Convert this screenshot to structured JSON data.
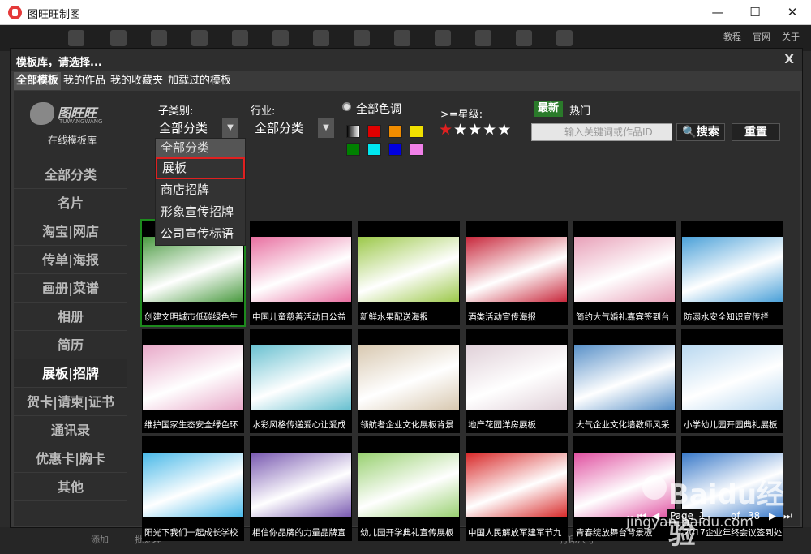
{
  "window": {
    "title": "图旺旺制图",
    "minimize": "—",
    "maximize": "☐",
    "close": "✕"
  },
  "background": {
    "links": [
      "教程",
      "官网",
      "关于"
    ],
    "bottom_add": "添加",
    "bottom_batch": "批处理",
    "bottom_print_size": "打印尺寸"
  },
  "dialog": {
    "title": "模板库，请选择...",
    "close": "X",
    "tabs": [
      "全部模板",
      "我的作品",
      "我的收藏夹",
      "加载过的模板"
    ],
    "logo_text": "图旺旺",
    "logo_sub": "TUWANGWANG",
    "logo_caption": "在线模板库",
    "sidebar": [
      "全部分类",
      "名片",
      "淘宝|网店",
      "传单|海报",
      "画册|菜谱",
      "相册",
      "简历",
      "展板|招牌",
      "贺卡|请柬|证书",
      "通讯录",
      "优惠卡|胸卡",
      "其他"
    ],
    "filters": {
      "subcategory_label": "子类别:",
      "subcategory_value": "全部分类",
      "industry_label": "行业:",
      "industry_value": "全部分类",
      "color_label": "全部色调",
      "stars_label": ">=星级:",
      "swatch_colors": [
        "gradient",
        "#e00000",
        "#f08c00",
        "#f0e000",
        "#008000",
        "#00e8f0",
        "#0000e0",
        "#f080e8"
      ],
      "dropdown_options": [
        "全部分类",
        "展板",
        "商店招牌",
        "形象宣传招牌",
        "公司宣传标语"
      ],
      "newest": "最新",
      "hot": "热门",
      "search_placeholder": "输入关键词或作品ID",
      "search_button": "搜索",
      "reset_button": "重置"
    },
    "templates": [
      {
        "label": "创建文明城市低碳绿色生",
        "color": "#4a9a40"
      },
      {
        "label": "中国儿童慈善活动日公益",
        "color": "#e86fa0"
      },
      {
        "label": "新鲜水果配送海报",
        "color": "#9cc84a"
      },
      {
        "label": "酒类活动宣传海报",
        "color": "#c8283c"
      },
      {
        "label": "简约大气婚礼嘉宾签到台",
        "color": "#e8a0b8"
      },
      {
        "label": "防溺水安全知识宣传栏",
        "color": "#4aa0d8"
      },
      {
        "label": "维护国家生态安全绿色环",
        "color": "#e8a8c8"
      },
      {
        "label": "水彩风格传递爱心让爱成",
        "color": "#68c0d0"
      },
      {
        "label": "领航者企业文化展板背景",
        "color": "#d8c8b0"
      },
      {
        "label": "地产花园洋房展板",
        "color": "#e0d0d8"
      },
      {
        "label": "大气企业文化墙教师风采",
        "color": "#5890c8"
      },
      {
        "label": "小学幼儿园开园典礼展板",
        "color": "#b8d8f0"
      },
      {
        "label": "阳光下我们一起成长学校",
        "color": "#48b8e8"
      },
      {
        "label": "相信你品牌的力量品牌宣",
        "color": "#7858b0"
      },
      {
        "label": "幼儿园开学典礼宣传展板",
        "color": "#98d070"
      },
      {
        "label": "中国人民解放军建军节九",
        "color": "#d82828"
      },
      {
        "label": "青春绽放舞台背景板",
        "color": "#e050a0"
      },
      {
        "label": "2017企业年终会议签到处",
        "color": "#3878c8"
      }
    ],
    "pager": {
      "page_label": "Page",
      "page_value": "1",
      "of_label": "of",
      "total": "38"
    }
  },
  "watermark": {
    "text": "Baidu经验",
    "sub": "jingyan.baidu.com"
  }
}
